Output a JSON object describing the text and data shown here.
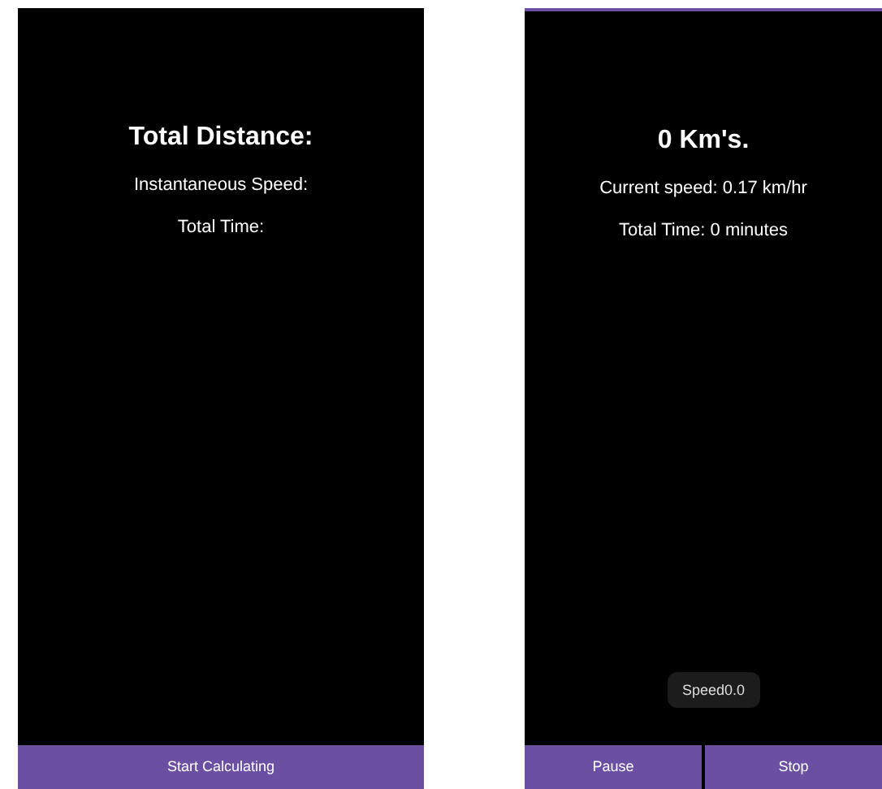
{
  "screens": [
    {
      "title": "Total Distance:",
      "speed": "Instantaneous Speed:",
      "time": "Total Time:",
      "buttons": [
        "Start Calculating"
      ]
    },
    {
      "title": "0 Km's.",
      "speed": "Current speed: 0.17 km/hr",
      "time": "Total Time: 0 minutes",
      "toast": "Speed0.0",
      "buttons": [
        "Pause",
        "Stop"
      ]
    }
  ]
}
